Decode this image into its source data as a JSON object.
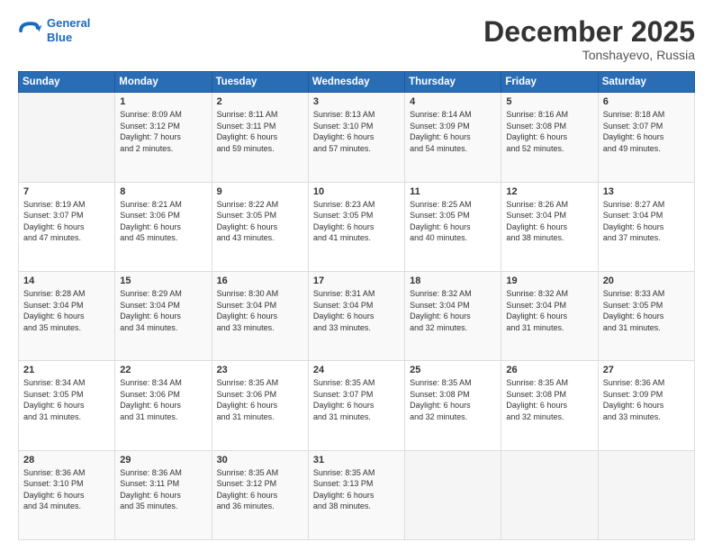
{
  "logo": {
    "line1": "General",
    "line2": "Blue"
  },
  "header": {
    "title": "December 2025",
    "subtitle": "Tonshayevo, Russia"
  },
  "weekdays": [
    "Sunday",
    "Monday",
    "Tuesday",
    "Wednesday",
    "Thursday",
    "Friday",
    "Saturday"
  ],
  "weeks": [
    [
      {
        "day": "",
        "info": ""
      },
      {
        "day": "1",
        "info": "Sunrise: 8:09 AM\nSunset: 3:12 PM\nDaylight: 7 hours\nand 2 minutes."
      },
      {
        "day": "2",
        "info": "Sunrise: 8:11 AM\nSunset: 3:11 PM\nDaylight: 6 hours\nand 59 minutes."
      },
      {
        "day": "3",
        "info": "Sunrise: 8:13 AM\nSunset: 3:10 PM\nDaylight: 6 hours\nand 57 minutes."
      },
      {
        "day": "4",
        "info": "Sunrise: 8:14 AM\nSunset: 3:09 PM\nDaylight: 6 hours\nand 54 minutes."
      },
      {
        "day": "5",
        "info": "Sunrise: 8:16 AM\nSunset: 3:08 PM\nDaylight: 6 hours\nand 52 minutes."
      },
      {
        "day": "6",
        "info": "Sunrise: 8:18 AM\nSunset: 3:07 PM\nDaylight: 6 hours\nand 49 minutes."
      }
    ],
    [
      {
        "day": "7",
        "info": "Sunrise: 8:19 AM\nSunset: 3:07 PM\nDaylight: 6 hours\nand 47 minutes."
      },
      {
        "day": "8",
        "info": "Sunrise: 8:21 AM\nSunset: 3:06 PM\nDaylight: 6 hours\nand 45 minutes."
      },
      {
        "day": "9",
        "info": "Sunrise: 8:22 AM\nSunset: 3:05 PM\nDaylight: 6 hours\nand 43 minutes."
      },
      {
        "day": "10",
        "info": "Sunrise: 8:23 AM\nSunset: 3:05 PM\nDaylight: 6 hours\nand 41 minutes."
      },
      {
        "day": "11",
        "info": "Sunrise: 8:25 AM\nSunset: 3:05 PM\nDaylight: 6 hours\nand 40 minutes."
      },
      {
        "day": "12",
        "info": "Sunrise: 8:26 AM\nSunset: 3:04 PM\nDaylight: 6 hours\nand 38 minutes."
      },
      {
        "day": "13",
        "info": "Sunrise: 8:27 AM\nSunset: 3:04 PM\nDaylight: 6 hours\nand 37 minutes."
      }
    ],
    [
      {
        "day": "14",
        "info": "Sunrise: 8:28 AM\nSunset: 3:04 PM\nDaylight: 6 hours\nand 35 minutes."
      },
      {
        "day": "15",
        "info": "Sunrise: 8:29 AM\nSunset: 3:04 PM\nDaylight: 6 hours\nand 34 minutes."
      },
      {
        "day": "16",
        "info": "Sunrise: 8:30 AM\nSunset: 3:04 PM\nDaylight: 6 hours\nand 33 minutes."
      },
      {
        "day": "17",
        "info": "Sunrise: 8:31 AM\nSunset: 3:04 PM\nDaylight: 6 hours\nand 33 minutes."
      },
      {
        "day": "18",
        "info": "Sunrise: 8:32 AM\nSunset: 3:04 PM\nDaylight: 6 hours\nand 32 minutes."
      },
      {
        "day": "19",
        "info": "Sunrise: 8:32 AM\nSunset: 3:04 PM\nDaylight: 6 hours\nand 31 minutes."
      },
      {
        "day": "20",
        "info": "Sunrise: 8:33 AM\nSunset: 3:05 PM\nDaylight: 6 hours\nand 31 minutes."
      }
    ],
    [
      {
        "day": "21",
        "info": "Sunrise: 8:34 AM\nSunset: 3:05 PM\nDaylight: 6 hours\nand 31 minutes."
      },
      {
        "day": "22",
        "info": "Sunrise: 8:34 AM\nSunset: 3:06 PM\nDaylight: 6 hours\nand 31 minutes."
      },
      {
        "day": "23",
        "info": "Sunrise: 8:35 AM\nSunset: 3:06 PM\nDaylight: 6 hours\nand 31 minutes."
      },
      {
        "day": "24",
        "info": "Sunrise: 8:35 AM\nSunset: 3:07 PM\nDaylight: 6 hours\nand 31 minutes."
      },
      {
        "day": "25",
        "info": "Sunrise: 8:35 AM\nSunset: 3:08 PM\nDaylight: 6 hours\nand 32 minutes."
      },
      {
        "day": "26",
        "info": "Sunrise: 8:35 AM\nSunset: 3:08 PM\nDaylight: 6 hours\nand 32 minutes."
      },
      {
        "day": "27",
        "info": "Sunrise: 8:36 AM\nSunset: 3:09 PM\nDaylight: 6 hours\nand 33 minutes."
      }
    ],
    [
      {
        "day": "28",
        "info": "Sunrise: 8:36 AM\nSunset: 3:10 PM\nDaylight: 6 hours\nand 34 minutes."
      },
      {
        "day": "29",
        "info": "Sunrise: 8:36 AM\nSunset: 3:11 PM\nDaylight: 6 hours\nand 35 minutes."
      },
      {
        "day": "30",
        "info": "Sunrise: 8:35 AM\nSunset: 3:12 PM\nDaylight: 6 hours\nand 36 minutes."
      },
      {
        "day": "31",
        "info": "Sunrise: 8:35 AM\nSunset: 3:13 PM\nDaylight: 6 hours\nand 38 minutes."
      },
      {
        "day": "",
        "info": ""
      },
      {
        "day": "",
        "info": ""
      },
      {
        "day": "",
        "info": ""
      }
    ]
  ]
}
